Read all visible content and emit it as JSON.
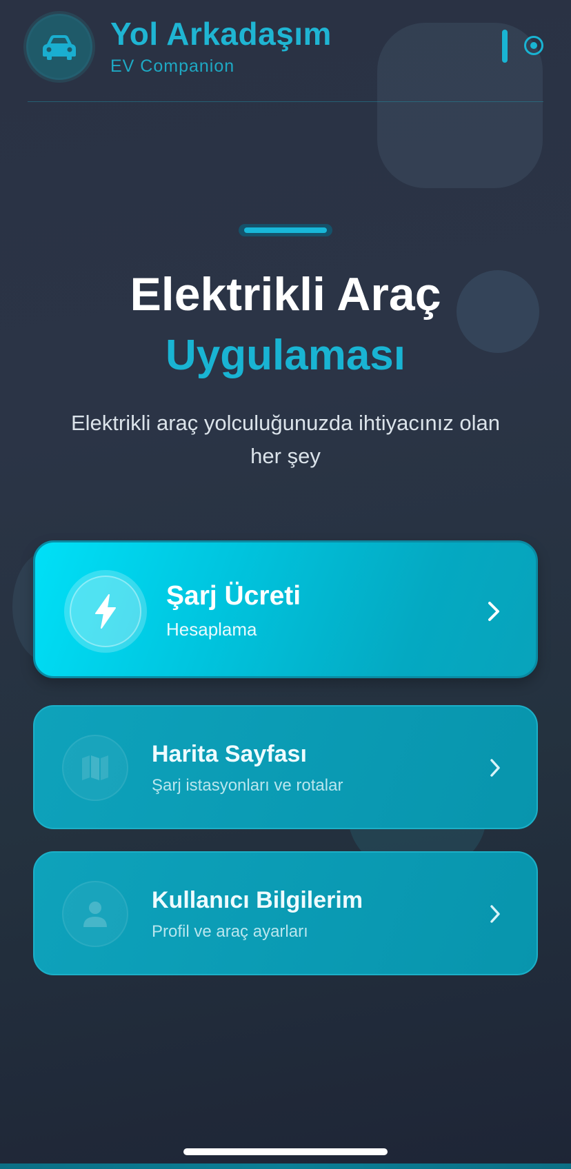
{
  "header": {
    "title": "Yol Arkadaşım",
    "subtitle": "EV Companion",
    "logo_icon": "car-icon"
  },
  "hero": {
    "title_line1": "Elektrikli Araç",
    "title_line2": "Uygulaması",
    "description": "Elektrikli araç yolculuğunuzda ihtiyacınız olan her şey"
  },
  "cards": [
    {
      "title": "Şarj Ücreti",
      "subtitle": "Hesaplama",
      "icon": "lightning-icon"
    },
    {
      "title": "Harita Sayfası",
      "subtitle": "Şarj istasyonları ve rotalar",
      "icon": "map-icon"
    },
    {
      "title": "Kullanıcı Bilgilerim",
      "subtitle": "Profil ve araç ayarları",
      "icon": "user-icon"
    }
  ],
  "colors": {
    "accent": "#19b4d3",
    "primary_card": "#00c6e0",
    "secondary_card": "#0a9ab3",
    "background": "#2a3244"
  }
}
